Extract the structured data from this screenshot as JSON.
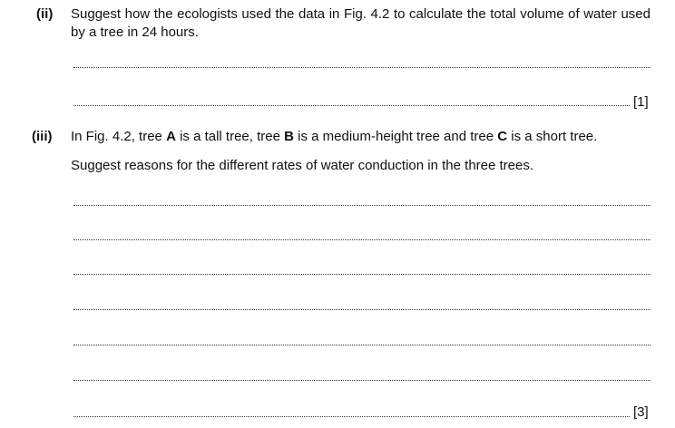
{
  "part_ii": {
    "number": "(ii)",
    "question": "Suggest how the ecologists used the data in Fig. 4.2 to calculate the total volume of water used by a tree in 24 hours.",
    "marks": "[1]"
  },
  "part_iii": {
    "number": "(iii)",
    "stem_prefix": "In Fig. 4.2, tree ",
    "tree_a": "A",
    "stem_mid1": " is a tall tree, tree ",
    "tree_b": "B",
    "stem_mid2": " is a medium-height tree and tree ",
    "tree_c": "C",
    "stem_suffix": " is a short tree.",
    "instruction": "Suggest reasons for the different rates of water conduction in the three trees.",
    "marks": "[3]"
  }
}
